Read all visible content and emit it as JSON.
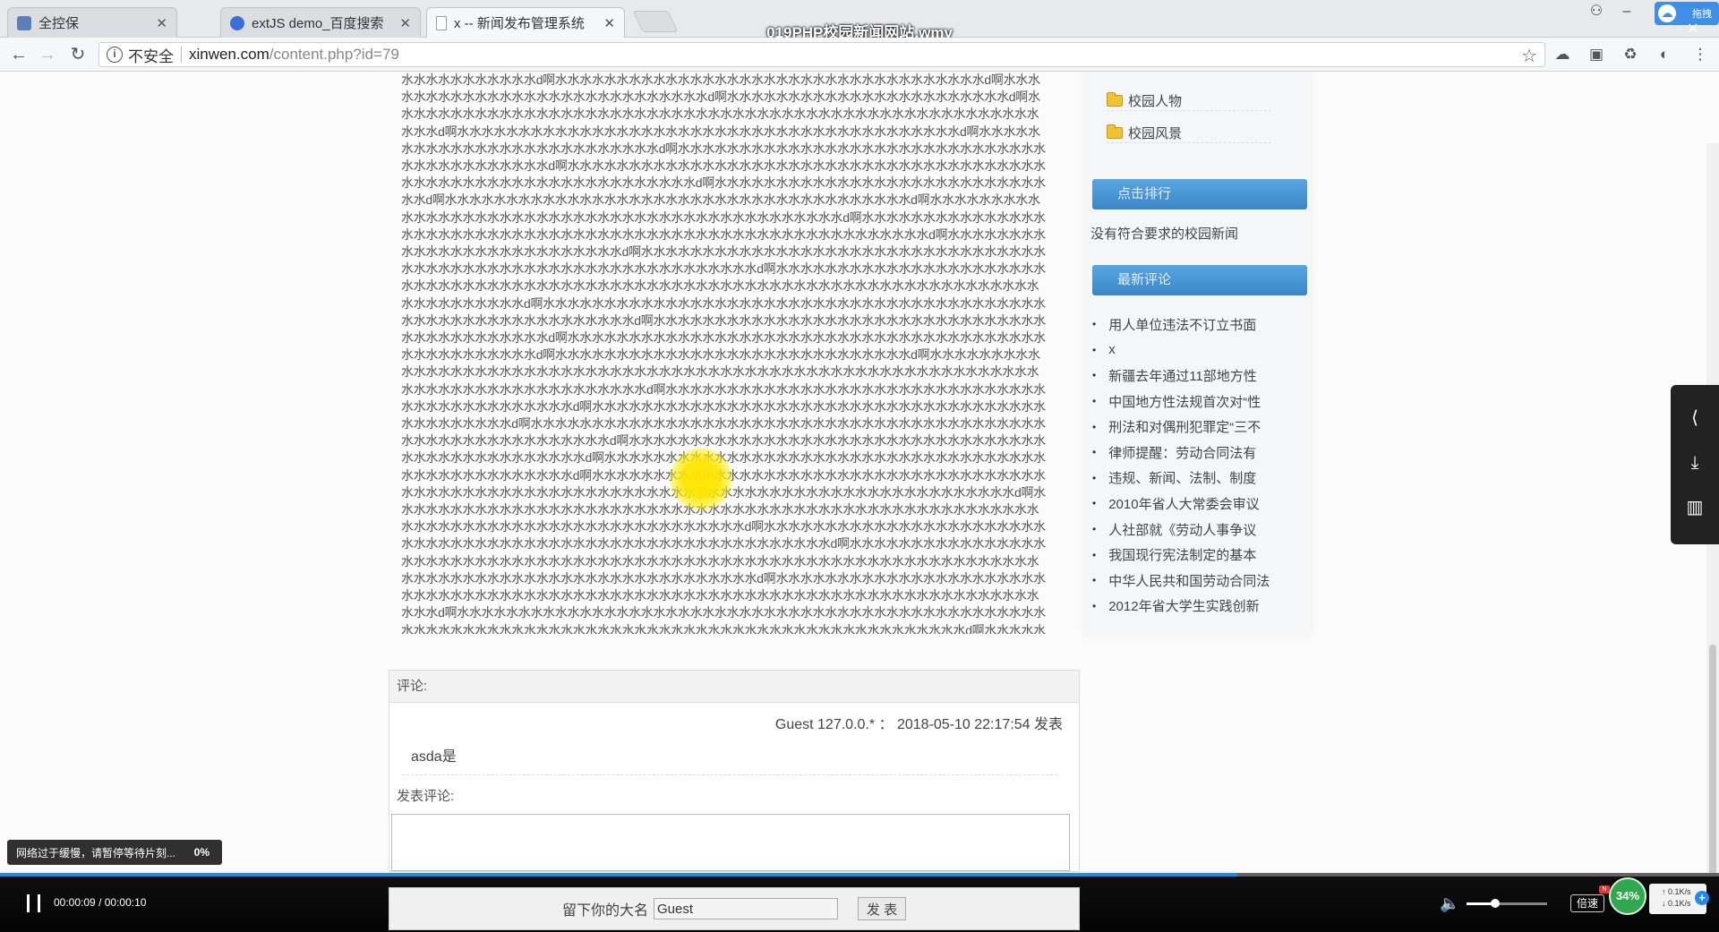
{
  "player": {
    "title": "019PHP校园新闻网站.wmv",
    "current_time": "00:00:09",
    "duration": "00:00:10",
    "progress_fraction": 0.9,
    "volume_fraction": 0.35,
    "speed_label": "倍速",
    "speed_badge": "N",
    "net_percent": "34%",
    "net_up": "↑  0.1K/s",
    "net_down": "↓  0.1K/s",
    "net_plus": "+",
    "cloud_label": "拖拽",
    "buffer_message": "网络过于缓慢，请暂停等待片刻...",
    "buffer_percent": "0%",
    "accent_color": "#1d8cf0"
  },
  "browser": {
    "tabs": [
      {
        "label": "全控保",
        "icon": "tab-icon",
        "icon_color": "#5b7fb8"
      },
      {
        "label": "extJS demo_百度搜索",
        "icon": "paw-icon",
        "icon_color": "#3a6fd8"
      },
      {
        "label": "x -- 新闻发布管理系统",
        "icon": "page-icon",
        "icon_color": "#9aa0a6"
      }
    ],
    "close_glyph": "✕",
    "insecure_label": "不安全",
    "url_host": "xinwen.com",
    "url_path": "/content.php?id=79"
  },
  "article": {
    "body": "水水水水水水水水水水水d啊水水水水水水水水水水水水水水水水水水水水水水水水水水水水水水水水水水水d啊水水水水水水水水水水水水水水水水水水水水水水水水水水水水d啊水水水水水水水水水水水水水水水水水水水水水水水d啊水水水水水水水水水水水水水水水水水水水水水水水水水水水水水水水水水水水水水水水水水水水水水水水水水水水水水水水水d啊水水水水水水水水水水水水水水水水水水水水水水水水水水水水水水水水水水水水水水水水水d啊水水水水水水水水水水水水水水水水水水水水水水水水水水d啊水水水水水水水水水水水水水水水水水水水水水水水水水水水水水水水水水水水水水水水水水水d啊水水水水水水水水水水水水水水水水水水水水水水水水水水水水水水水水水水水水水水水水水水水水水水水水水水水水水水水水水水水水水水水d啊水水水水水水水水水水水水水水水水水水水水水水水水水水水水水d啊水水水水水水水水水水水水水水水水水水水水水水水水水水水水水水水水水水水水水水d啊水水水水水水水水水水水水水水水水水水水水水水水水水水水水水水水水水水水水水水水水水水水水水d啊水水水水水水水水水水水水水水水水水水水水水水水水水水水水水水水水水水水水水水水水水水水水水水水水水水水水水水水水水水d啊水水水水水水水水水水水水水水水水水水水水水水水水水水d啊水水水水水水水水水水水水水水水水水水水水水水水水水水水水水水水水水水水水水水水水水水水水水水水水水水水水水水水水水水水水水水d啊水水水水水水水水水水水水水水水水水水水水水水水水水水水水水水水水水水水水水水水水水水水水水水水水水水水水水水水水水水水水水水水水水水水水水水水水水水水水水水水水水水水水d啊水水水水水水水水水水水水水水水水水水水水水水水水水水水水水水水水水水水水水水水水水水水水水水水水水水水水水水水水水水水水d啊水水水水水水水水水水水水水水水水水水水水水水水水水水水水水水水水水水水水水水水水水水水水d啊水水水水水水水水水水水水水水水水水水水水水水水水水水水水水水水水水水水水水水水水水水水水水水水水水水d啊水水水水水水水水水水水水水水水水水水水水水水水水水水水水水d啊水水水水水水水水水水水水水水水水水水水水水水水水水水水水水水水水水水水水水水水水水水水水水水水水水水水水水水水水水水水水水水水水水水水水水水水水水水水水水水水水水d啊水水水水水水水水水水水水水水水水水水水水水水水水水水水水水水水水水水水水水水水水水水水水水d啊水水水水水水水水水水水水水水水水水水水水水水水水水水水水水水水水水水水水水水水水水水水水水水d啊水水水水水水水水水水水水水水水水水水水水水水水水水水水水水水水水水水水水水水水水水水水水水水水水水水水水水水水水水水水d啊水水水水水水水水水水水水水水水水水水水水水水水水水水水水水水水水水水水水水水水水水水水水水水水水水d啊水水水水水水水水水水水水水水水水水水水水水水水水水水水水水水水水水水水水水水水水水水水水水水水水水水d啊水水水水水水水水水水水水水水水水水水水水水水水水水水水水水水水水水水水水水水水水水水水水水水水水水水水水水水水水水水水水水水水水水水水水水水水水水水水水水水水水水水水水水水水d啊水水水水水水水水水水水水水水水水水水水水水水水水水水水水水水水水水水水水水水水水水水水水水水水水水水水水水水水水水水水水水水水水水水水水水水水水水水水水水水水水水d啊水水水水水水水水水水水水水水水水水水水水水水水水水水水水水水水水水水水水水水水水水水水水水水水水水水水水水水水水水水d啊水水水水水水水水水水水水水水水水水水水水水水水水水水水水水水水水水水水水水水水水水水水水水水水水水水水水水水水水水水水水水水水水水水水水水水水水水水水水水水水水水水水水水水水水水水水水水水水水水d啊水水水水水水水水水水水水水水水水水水水水水水水水水水水水水水水水水水水水水水水水水水水水水水水水水水水水水水水水水水水水水水水水水水水水水水水水水水水水水d啊水水水水水水水水水水水水水水水水水水水水水水水水水水水水水水水水水水水水水水水水水水水水水水水水水水水水水水水水水水水水水水水水水水水水水水水水水水水水水水水水水水水水水水水水水水水水水水d啊水水水水水水水水水水水水水水水水水水水水水水水水水水水水水水水水水水水水水水水水水水水水水水水水水水水水水水水水水水水水水水水水水水水水水水水水水水水d啊水水水水水水水水水水水水水水水水水水水水水水水水水水水水水水水水水水水水水水水水水水水水水水水水水水水水水水水水水水水水水水水水水水水水水水水水水水水水水水水水水水水水水水水水水水水水水水水水水水水水水水水水水水水水d啊水水水水水水水水水水水水水水水水水水水水水水水水水水水水水水水水水水水水水水水水水水水水水水水水水水水水水水水水水水水水水d啊水水水水水水水水水水水水水水水水水水水水水水水水水水水水水水水水水水水水水水水水水水水水水水水水水水水水水水水水水水水水水水水水水水水水水水水水水水水水水水水水水水水水水水水水水水水水水水水水水d啊水水水水水水水水水水水水水水水水水水水水水水水水水水水水水水水水水水水水水水水水水水水水水水水水水水水水水水水水水水水水水水水水d啊水水水水水水水水水水水水水水水水水水水水水水水水水水水水水水水水水水水水水水水水水水水水水水水水水水水水水水水水水水水水水水水水水水水水水水水水水水水水水d啊水水水水水水水水水水水水水水水水水水水水水水水水水水水水水水水水水水水水水水水水水水水水水水水水水水水水水水水水水水水水d"
  },
  "sidebar": {
    "categories": [
      "校园人物",
      "校园风景"
    ],
    "ranking_header": "点击排行",
    "ranking_empty": "没有符合要求的校园新闻",
    "comments_header": "最新评论",
    "recent_comments": [
      "用人单位违法不订立书面",
      "x",
      "新疆去年通过11部地方性",
      "中国地方性法规首次对“性",
      "刑法和对偶刑犯罪定“三不",
      "律师提醒：劳动合同法有",
      "违规、新闻、法制、制度",
      "2010年省人大常委会审议",
      "人社部就《劳动人事争议",
      "我国现行宪法制定的基本",
      "中华人民共和国劳动合同法",
      "2012年省大学生实践创新"
    ]
  },
  "comments": {
    "header": "评论:",
    "entries": [
      {
        "meta": "Guest  127.0.0.*  ：  2018-05-10 22:17:54  发表",
        "body": "asda是"
      }
    ],
    "post_header": "发表评论:",
    "name_label": "留下你的大名",
    "name_value": "Guest",
    "submit_label": "发 表"
  }
}
